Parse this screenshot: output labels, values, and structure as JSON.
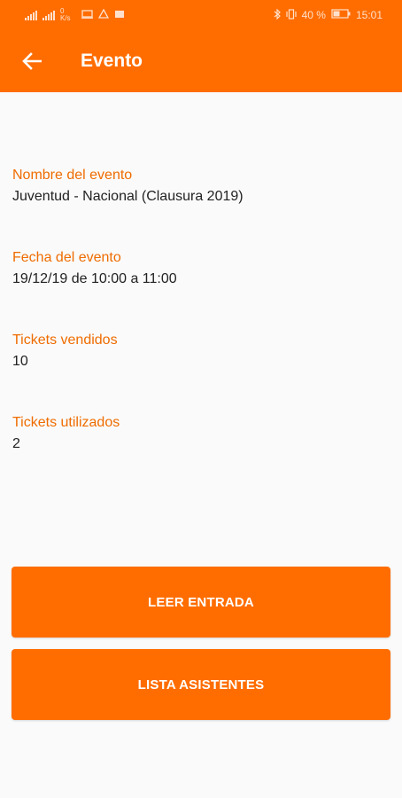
{
  "status_bar": {
    "left_text": "0 K/s",
    "battery": "40 %",
    "time": "15:01"
  },
  "app_bar": {
    "title": "Evento",
    "back_icon": "arrow-left-icon"
  },
  "fields": [
    {
      "label": "Nombre del evento",
      "value": "Juventud - Nacional (Clausura 2019)"
    },
    {
      "label": "Fecha del evento",
      "value": "19/12/19 de 10:00 a 11:00"
    },
    {
      "label": "Tickets vendidos",
      "value": "10"
    },
    {
      "label": "Tickets utilizados",
      "value": "2"
    }
  ],
  "buttons": {
    "read_ticket": "LEER ENTRADA",
    "attendee_list": "LISTA ASISTENTES"
  },
  "colors": {
    "primary": "#ff6d00",
    "label": "#ef6c00",
    "background": "#fafafa"
  }
}
